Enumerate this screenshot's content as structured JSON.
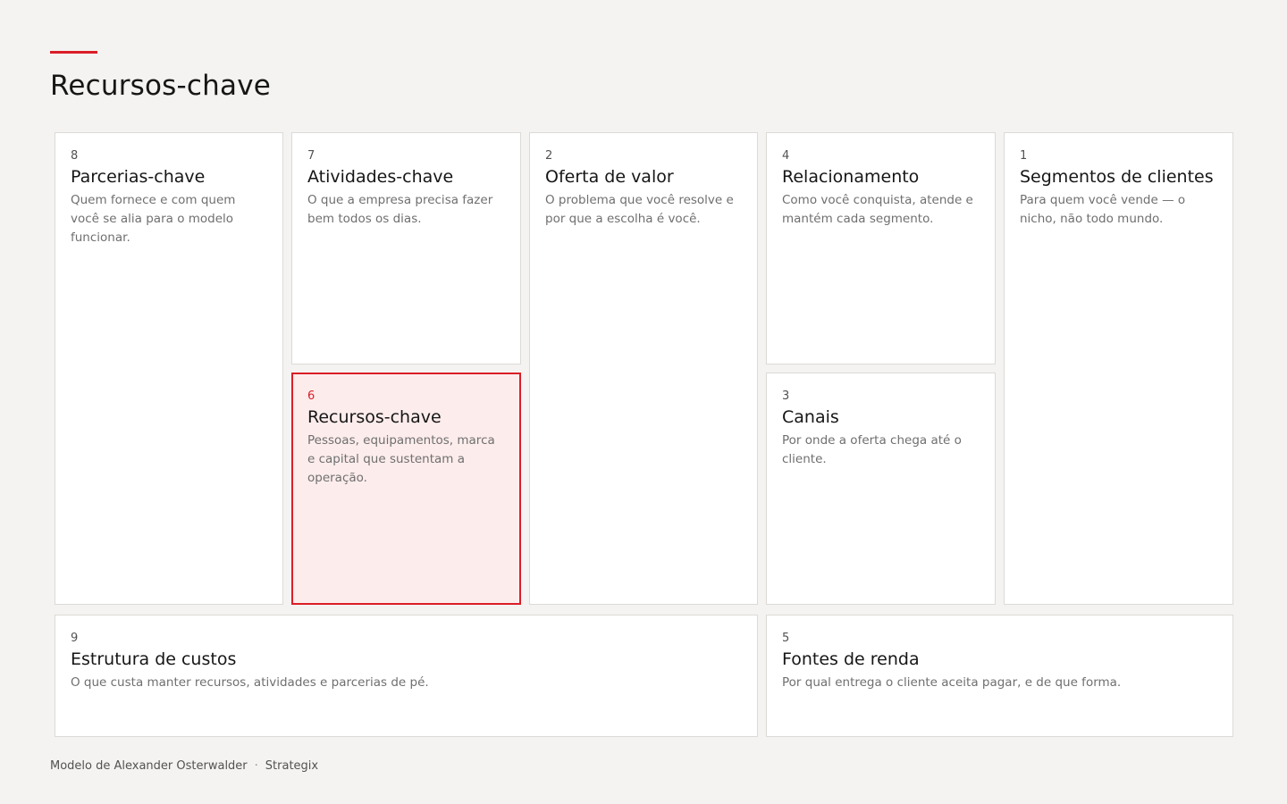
{
  "page": {
    "title": "Recursos-chave",
    "accent_color": "#da1e28"
  },
  "blocks": {
    "parcerias": {
      "number": "8",
      "title": "Parcerias-chave",
      "description": "Quem fornece e com quem você se alia para o modelo funcionar."
    },
    "atividades": {
      "number": "7",
      "title": "Atividades-chave",
      "description": "O que a empresa precisa fazer bem todos os dias."
    },
    "recursos": {
      "number": "6",
      "title": "Recursos-chave",
      "description": "Pessoas, equipamentos, marca e capital que sustentam a operação.",
      "active": true
    },
    "oferta": {
      "number": "2",
      "title": "Oferta de valor",
      "description": "O problema que você resolve e por que a escolha é você."
    },
    "relacionamento": {
      "number": "4",
      "title": "Relacionamento",
      "description": "Como você conquista, atende e mantém cada segmento."
    },
    "canais": {
      "number": "3",
      "title": "Canais",
      "description": "Por onde a oferta chega até o cliente."
    },
    "segmentos": {
      "number": "1",
      "title": "Segmentos de clientes",
      "description": "Para quem você vende — o nicho, não todo mundo."
    },
    "custos": {
      "number": "9",
      "title": "Estrutura de custos",
      "description": "O que custa manter recursos, atividades e parcerias de pé."
    },
    "fontes": {
      "number": "5",
      "title": "Fontes de renda",
      "description": "Por qual entrega o cliente aceita pagar, e de que forma."
    }
  },
  "footer": {
    "credit": "Modelo de Alexander Osterwalder",
    "separator": "·",
    "brand": "Strategix"
  }
}
